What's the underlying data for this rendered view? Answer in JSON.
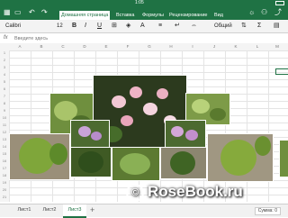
{
  "status_bar": {
    "time": "1:05"
  },
  "ribbon": {
    "tabs": [
      "Домашняя страница",
      "Вставка",
      "Формулы",
      "Рецензирование",
      "Вид"
    ],
    "active_tab": 0
  },
  "toolbar": {
    "font_name": "Calibri",
    "font_size": "12",
    "number_format": "Общий"
  },
  "formula_bar": {
    "fx_label": "fx",
    "placeholder": "Введите здесь"
  },
  "columns": [
    "A",
    "B",
    "C",
    "D",
    "E",
    "F",
    "G",
    "H",
    "I",
    "J",
    "K",
    "L",
    "M"
  ],
  "rows": [
    "1",
    "2",
    "3",
    "4",
    "5",
    "6",
    "7",
    "8",
    "9",
    "10",
    "11",
    "12",
    "13",
    "14",
    "15",
    "16",
    "17",
    "18",
    "19",
    "20",
    "21",
    "22",
    "23",
    "24",
    "25",
    "26",
    "27"
  ],
  "watermark": {
    "text": "RoseBook.ru",
    "symbol": "©"
  },
  "sheets": {
    "tabs": [
      "Лист1",
      "Лист2",
      "Лист3"
    ],
    "active": 2,
    "add_label": "+"
  },
  "status": {
    "sum_label": "Сумма: 0"
  }
}
